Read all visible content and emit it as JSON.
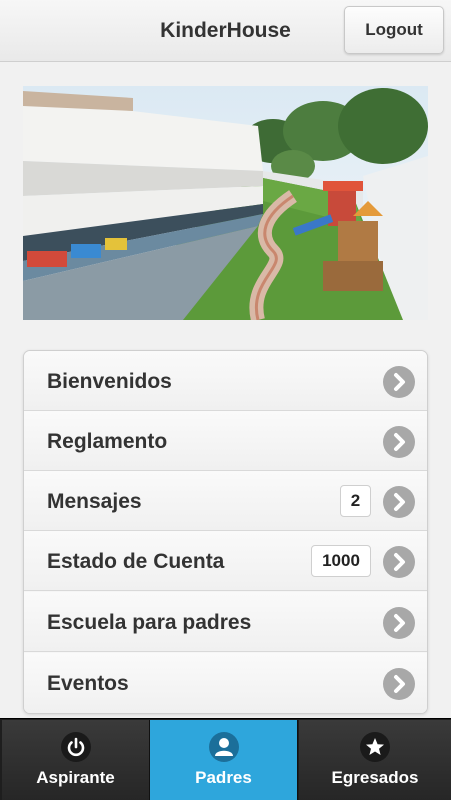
{
  "header": {
    "title": "KinderHouse",
    "logout_label": "Logout"
  },
  "menu": {
    "items": [
      {
        "label": "Bienvenidos",
        "icon": "chevron-right-icon"
      },
      {
        "label": "Reglamento",
        "icon": "chevron-right-icon"
      },
      {
        "label": "Mensajes",
        "count": "2",
        "icon": "chevron-right-icon"
      },
      {
        "label": "Estado de Cuenta",
        "count": "1000",
        "icon": "chevron-right-icon"
      },
      {
        "label": "Escuela para padres",
        "icon": "chevron-right-icon"
      },
      {
        "label": "Eventos",
        "icon": "chevron-right-icon"
      }
    ]
  },
  "navbar": {
    "items": [
      {
        "label": "Aspirante",
        "icon": "power-icon"
      },
      {
        "label": "Padres",
        "icon": "user-icon",
        "active": true
      },
      {
        "label": "Egresados",
        "icon": "star-icon"
      }
    ]
  },
  "colors": {
    "accent": "#2ea6dc",
    "navbar_bg": "#262626",
    "chevron_circle": "#a8a8a8"
  }
}
